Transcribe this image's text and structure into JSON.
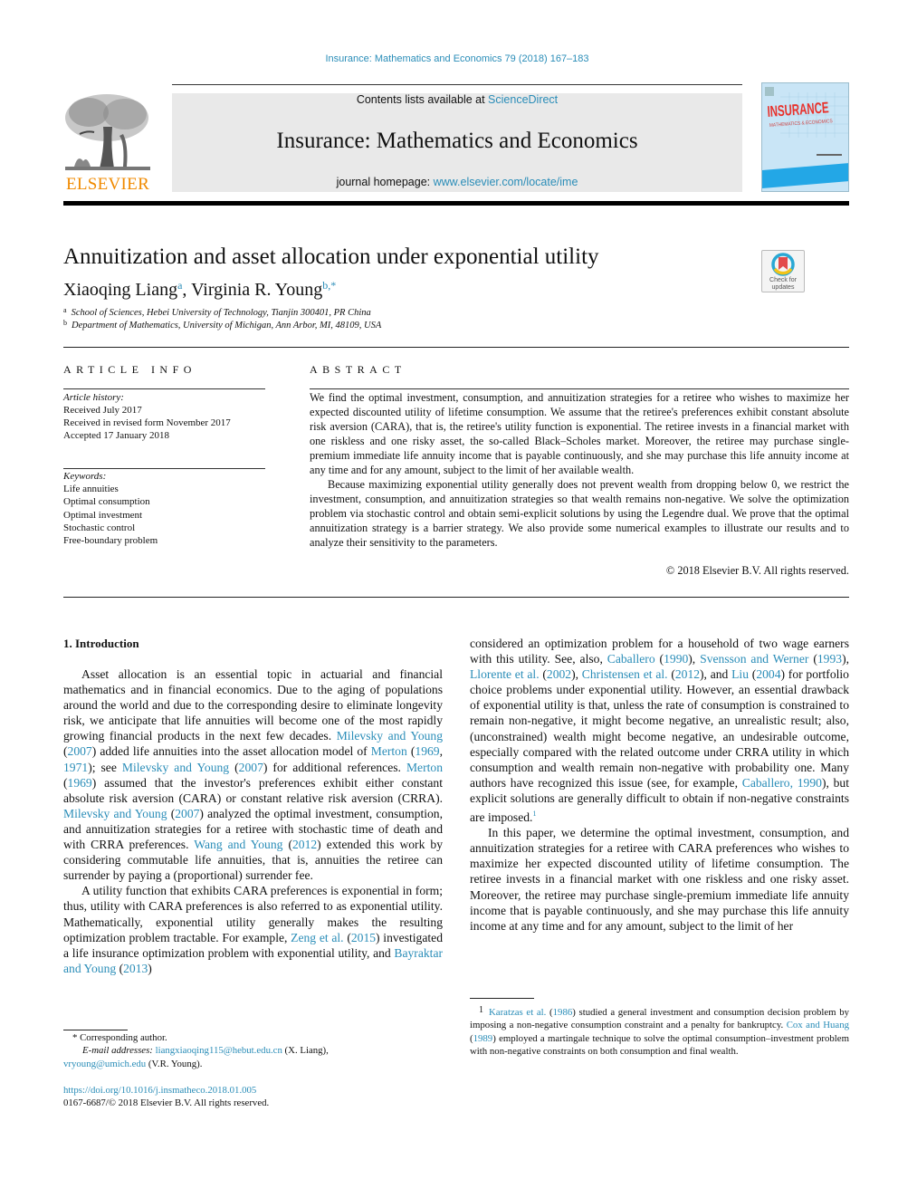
{
  "running_head": "Insurance: Mathematics and Economics 79 (2018) 167–183",
  "masthead": {
    "contents_prefix": "Contents lists available at ",
    "contents_link": "ScienceDirect",
    "journal_title": "Insurance: Mathematics and Economics",
    "homepage_prefix": "journal homepage: ",
    "homepage_link": "www.elsevier.com/locate/ime",
    "publisher_wordmark": "ELSEVIER",
    "cover_title": "INSURANCE",
    "cover_subtitle": "MATHEMATICS & ECONOMICS"
  },
  "colors": {
    "link": "#2a8db8",
    "elsevier_orange": "#f08a00",
    "masthead_bg": "#e9e9e9",
    "cover_bg": "#c9e5f6",
    "cover_title": "#e8322c"
  },
  "article": {
    "title": "Annuitization and asset allocation under exponential utility",
    "authors": [
      {
        "name": "Xiaoqing Liang",
        "sup": "a"
      },
      {
        "name": "Virginia R. Young",
        "sup": "b,*"
      }
    ],
    "author_separator": ", ",
    "affiliations": [
      {
        "label": "a",
        "text": "School of Sciences, Hebei University of Technology, Tianjin 300401, PR China"
      },
      {
        "label": "b",
        "text": "Department of Mathematics, University of Michigan, Ann Arbor, MI, 48109, USA"
      }
    ],
    "check_updates_label": "Check for updates"
  },
  "article_info": {
    "heading": "ARTICLE INFO",
    "history_label": "Article history:",
    "history": [
      "Received July 2017",
      "Received in revised form November 2017",
      "Accepted 17 January 2018"
    ],
    "keywords_label": "Keywords:",
    "keywords": [
      "Life annuities",
      "Optimal consumption",
      "Optimal investment",
      "Stochastic control",
      "Free-boundary problem"
    ]
  },
  "abstract": {
    "heading": "ABSTRACT",
    "paragraphs": [
      "We find the optimal investment, consumption, and annuitization strategies for a retiree who wishes to maximize her expected discounted utility of lifetime consumption. We assume that the retiree's preferences exhibit constant absolute risk aversion (CARA), that is, the retiree's utility function is exponential. The retiree invests in a financial market with one riskless and one risky asset, the so-called Black–Scholes market. Moreover, the retiree may purchase single-premium immediate life annuity income that is payable continuously, and she may purchase this life annuity income at any time and for any amount, subject to the limit of her available wealth.",
      "Because maximizing exponential utility generally does not prevent wealth from dropping below 0, we restrict the investment, consumption, and annuitization strategies so that wealth remains non-negative. We solve the optimization problem via stochastic control and obtain semi-explicit solutions by using the Legendre dual. We prove that the optimal annuitization strategy is a barrier strategy. We also provide some numerical examples to illustrate our results and to analyze their sensitivity to the parameters."
    ],
    "copyright": "© 2018 Elsevier B.V. All rights reserved."
  },
  "introduction": {
    "heading": "1. Introduction",
    "left_paragraphs": [
      [
        {
          "t": "Asset allocation is an essential topic in actuarial and financial mathematics and in financial economics. Due to the aging of populations around the world and due to the corresponding desire to eliminate longevity risk, we anticipate that life annuities will become one of the most rapidly growing financial products in the next few decades. "
        },
        {
          "t": "Milevsky and Young",
          "link": true
        },
        {
          "t": " ("
        },
        {
          "t": "2007",
          "link": true
        },
        {
          "t": ") added life annuities into the asset allocation model of "
        },
        {
          "t": "Merton",
          "link": true
        },
        {
          "t": " ("
        },
        {
          "t": "1969",
          "link": true
        },
        {
          "t": ", "
        },
        {
          "t": "1971",
          "link": true
        },
        {
          "t": "); see "
        },
        {
          "t": "Milevsky and Young",
          "link": true
        },
        {
          "t": " ("
        },
        {
          "t": "2007",
          "link": true
        },
        {
          "t": ") for additional references. "
        },
        {
          "t": "Merton",
          "link": true
        },
        {
          "t": " ("
        },
        {
          "t": "1969",
          "link": true
        },
        {
          "t": ") assumed that the investor's preferences exhibit either constant absolute risk aversion (CARA) or constant relative risk aversion (CRRA). "
        },
        {
          "t": "Milevsky and Young",
          "link": true
        },
        {
          "t": " ("
        },
        {
          "t": "2007",
          "link": true
        },
        {
          "t": ") analyzed the optimal investment, consumption, and annuitization strategies for a retiree with stochastic time of death and with CRRA preferences. "
        },
        {
          "t": "Wang and Young",
          "link": true
        },
        {
          "t": " ("
        },
        {
          "t": "2012",
          "link": true
        },
        {
          "t": ") extended this work by considering commutable life annuities, that is, annuities the retiree can surrender by paying a (proportional) surrender fee."
        }
      ],
      [
        {
          "t": "A utility function that exhibits CARA preferences is exponential in form; thus, utility with CARA preferences is also referred to as exponential utility. Mathematically, exponential utility generally makes the resulting optimization problem tractable. For example, "
        },
        {
          "t": "Zeng et al.",
          "link": true
        },
        {
          "t": " ("
        },
        {
          "t": "2015",
          "link": true
        },
        {
          "t": ") investigated a life insurance optimization problem with exponential utility, and "
        },
        {
          "t": "Bayraktar and Young",
          "link": true
        },
        {
          "t": " ("
        },
        {
          "t": "2013",
          "link": true
        },
        {
          "t": ")"
        }
      ]
    ],
    "right_paragraphs": [
      [
        {
          "t": "considered an optimization problem for a household of two wage earners with this utility. See, also, "
        },
        {
          "t": "Caballero",
          "link": true
        },
        {
          "t": " ("
        },
        {
          "t": "1990",
          "link": true
        },
        {
          "t": "), "
        },
        {
          "t": "Svensson and Werner",
          "link": true
        },
        {
          "t": " ("
        },
        {
          "t": "1993",
          "link": true
        },
        {
          "t": "), "
        },
        {
          "t": "Llorente et al.",
          "link": true
        },
        {
          "t": " ("
        },
        {
          "t": "2002",
          "link": true
        },
        {
          "t": "), "
        },
        {
          "t": "Christensen et al.",
          "link": true
        },
        {
          "t": " ("
        },
        {
          "t": "2012",
          "link": true
        },
        {
          "t": "), and "
        },
        {
          "t": "Liu",
          "link": true
        },
        {
          "t": " ("
        },
        {
          "t": "2004",
          "link": true
        },
        {
          "t": ") for portfolio choice problems under exponential utility. However, an essential drawback of exponential utility is that, unless the rate of consumption is constrained to remain non-negative, it might become negative, an unrealistic result; also, (unconstrained) wealth might become negative, an undesirable outcome, especially compared with the related outcome under CRRA utility in which consumption and wealth remain non-negative with probability one. Many authors have recognized this issue (see, for example, "
        },
        {
          "t": "Caballero, 1990",
          "link": true
        },
        {
          "t": "), but explicit solutions are generally difficult to obtain if non-negative constraints are imposed."
        },
        {
          "t": "1",
          "sup": true
        }
      ],
      [
        {
          "t": "In this paper, we determine the optimal investment, consumption, and annuitization strategies for a retiree with CARA preferences who wishes to maximize her expected discounted utility of lifetime consumption. The retiree invests in a financial market with one riskless and one risky asset. Moreover, the retiree may purchase single-premium immediate life annuity income that is payable continuously, and she may purchase this life annuity income at any time and for any amount, subject to the limit of her"
        }
      ]
    ]
  },
  "footnotes": {
    "corresponding_mark": "*",
    "corresponding_text": "Corresponding author.",
    "email_label": "E-mail addresses: ",
    "email_1": "liangxiaoqing115@hebut.edu.cn",
    "email_1_owner": " (X. Liang),",
    "email_2": "vryoung@umich.edu",
    "email_2_owner": " (V.R. Young).",
    "doi": "https://doi.org/10.1016/j.insmatheco.2018.01.005",
    "issn_line": "0167-6687/© 2018 Elsevier B.V. All rights reserved.",
    "fn1_number": "1",
    "fn1": [
      {
        "t": "Karatzas et al.",
        "link": true
      },
      {
        "t": " ("
      },
      {
        "t": "1986",
        "link": true
      },
      {
        "t": ") studied a general investment and consumption decision problem by imposing a non-negative consumption constraint and a penalty for bankruptcy. "
      },
      {
        "t": "Cox and Huang",
        "link": true
      },
      {
        "t": " ("
      },
      {
        "t": "1989",
        "link": true
      },
      {
        "t": ") employed a martingale technique to solve the optimal consumption–investment problem with non-negative constraints on both consumption and final wealth."
      }
    ]
  }
}
